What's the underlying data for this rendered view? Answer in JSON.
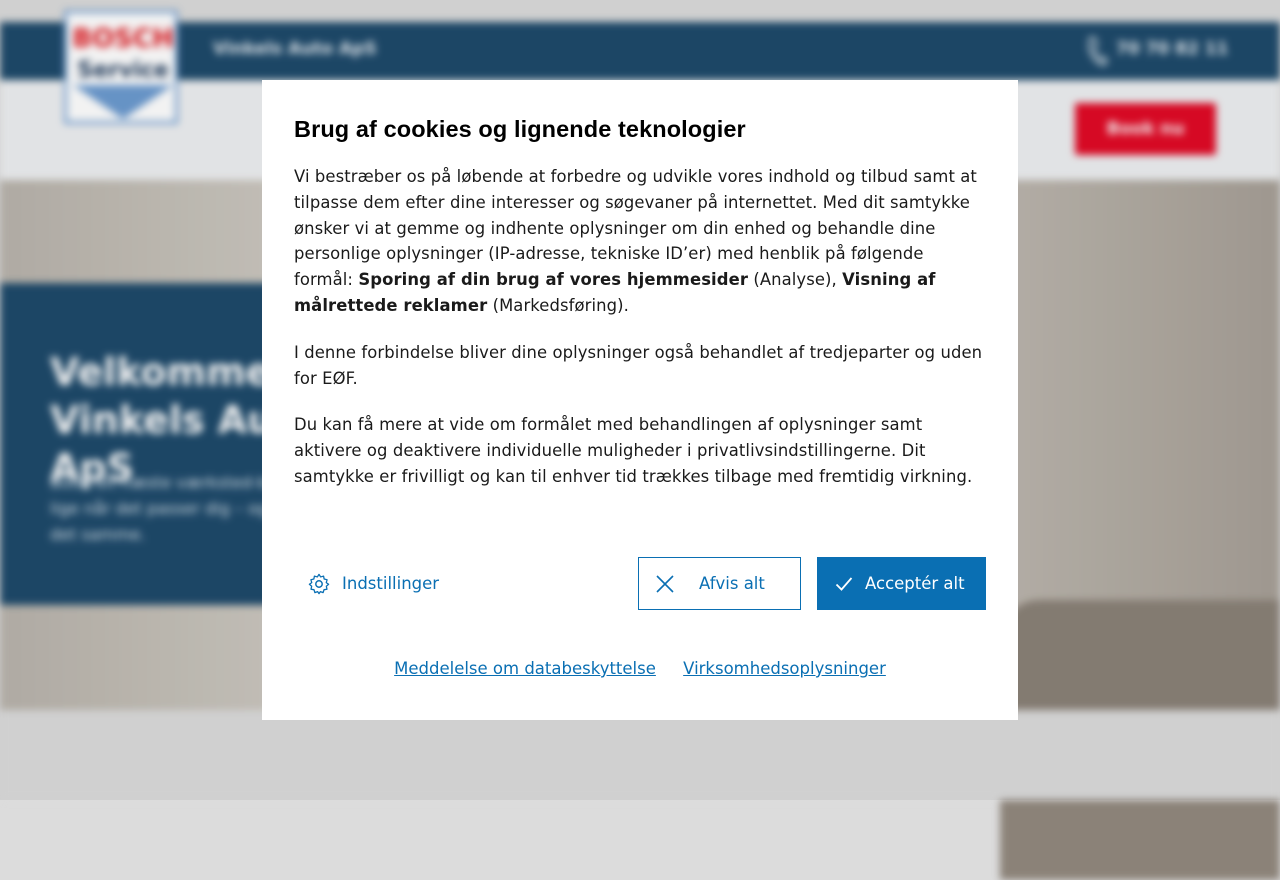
{
  "background": {
    "company_name": "Vinkels Auto ApS",
    "phone": "70 70 82 11",
    "book_button": "Book nu",
    "logo": {
      "line1": "BOSCH",
      "line2": "Service"
    },
    "welcome_title": "Velkommen til Vinkels Auto ApS",
    "welcome_text": "Book dit næste værksted-besøg online, lige når det passer dig – og få pris med det samme."
  },
  "dialog": {
    "title": "Brug af cookies og lignende teknologier",
    "p1_text": "Vi bestræber os på løbende at forbedre og udvikle vores indhold og tilbud samt at tilpasse dem efter dine interesser og søgevaner på internettet. Med dit samtykke ønsker vi at gemme og indhente oplysninger om din enhed og behandle dine personlige oplysninger (IP-adresse, tekniske ID’er) med henblik på følgende formål: ",
    "p1_bold1": "Sporing af din brug af vores hjemmesider",
    "p1_mid": " (Analyse), ",
    "p1_bold2": "Visning af målrettede reklamer",
    "p1_end": " (Markedsføring).",
    "p2": "I denne forbindelse bliver dine oplysninger også behandlet af tredjeparter og uden for EØF.",
    "p3": "Du kan få mere at vide om formålet med behandlingen af oplysninger samt aktivere og deaktivere individuelle muligheder i privatlivsindstillingerne. Dit samtykke er frivilligt og kan til enhver tid trækkes tilbage med fremtidig virkning.",
    "settings_label": "Indstillinger",
    "reject_label": "Afvis alt",
    "accept_label": "Acceptér alt",
    "link_privacy": "Meddelelse om databeskyttelse",
    "link_company": "Virksomhedsoplysninger"
  },
  "colors": {
    "accent": "#0a6fb3",
    "header": "#1e4a6b",
    "book_button": "#e20a26"
  },
  "icons": [
    "gear-icon",
    "close-icon",
    "check-icon",
    "phone-icon"
  ]
}
